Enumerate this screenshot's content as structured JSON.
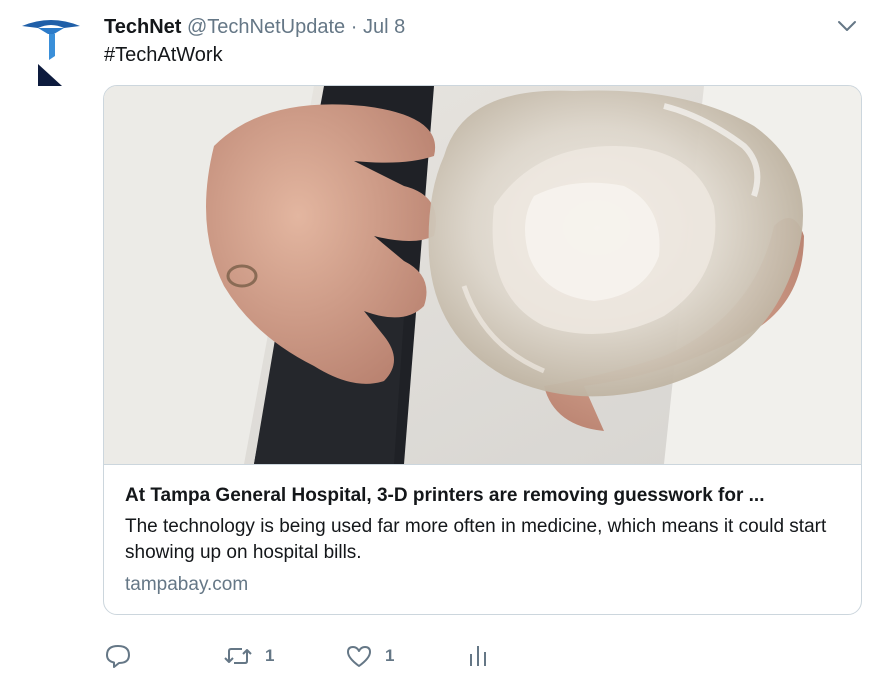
{
  "tweet": {
    "display_name": "TechNet",
    "handle": "@TechNetUpdate",
    "separator": "·",
    "timestamp": "Jul 8",
    "text": "#TechAtWork",
    "avatar_icon": "technet-logo-icon",
    "menu_icon": "chevron-down-icon"
  },
  "card": {
    "image_description_icon": "3d-printed-heart-photo",
    "title": "At Tampa General Hospital, 3-D printers are removing guesswork for ...",
    "description": "The technology is being used far more often in medicine, which means it could start showing up on hospital bills.",
    "domain": "tampabay.com"
  },
  "actions": {
    "reply": {
      "icon": "reply-icon",
      "count": ""
    },
    "retweet": {
      "icon": "retweet-icon",
      "count": "1"
    },
    "like": {
      "icon": "heart-icon",
      "count": "1"
    },
    "analytics": {
      "icon": "analytics-icon",
      "count": ""
    }
  },
  "colors": {
    "text": "#14171a",
    "secondary": "#657786",
    "border": "#ccd6dd",
    "logo_blue": "#1f5fa8",
    "logo_navy": "#0d1b3d"
  }
}
